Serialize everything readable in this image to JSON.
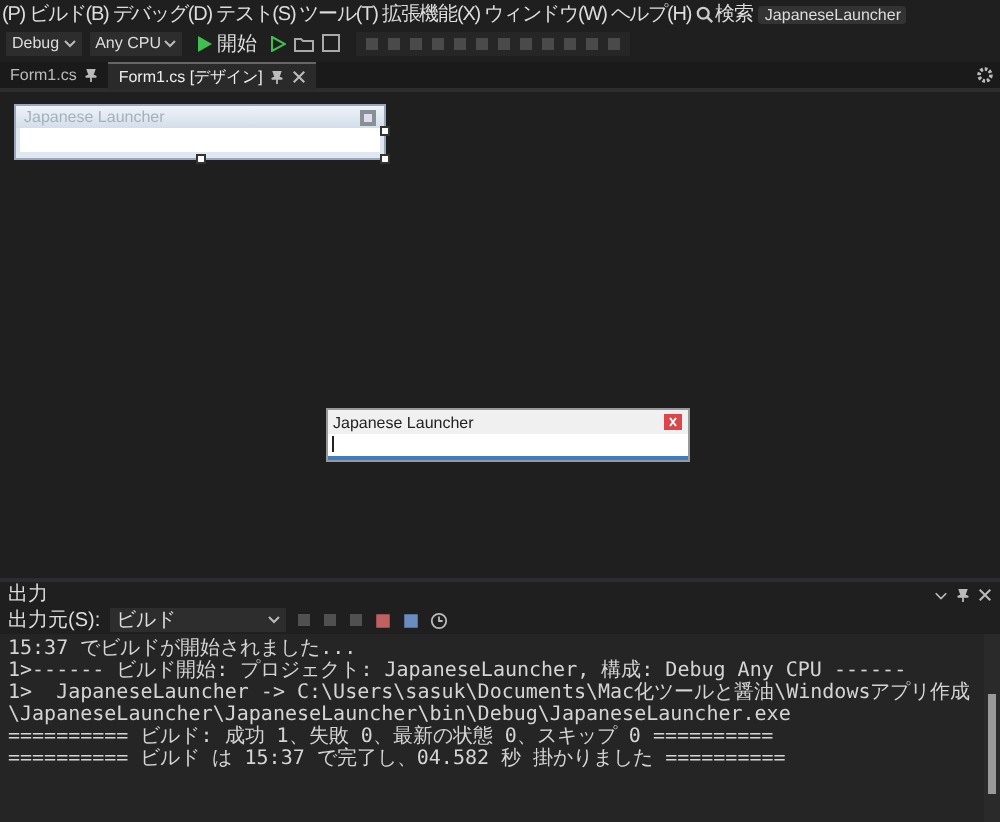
{
  "menu": {
    "items": [
      "(P)",
      "ビルド(B)",
      "デバッグ(D)",
      "テスト(S)",
      "ツール(T)",
      "拡張機能(X)",
      "ウィンドウ(W)",
      "ヘルプ(H)"
    ],
    "search": "検索",
    "solution": "JapaneseLauncher"
  },
  "toolbar": {
    "configuration": "Debug",
    "platform": "Any CPU",
    "start": "開始"
  },
  "tabs": [
    {
      "label": "Form1.cs",
      "selected": false,
      "closable": false
    },
    {
      "label": "Form1.cs [デザイン]",
      "selected": true,
      "closable": true
    }
  ],
  "designer": {
    "form_title": "Japanese Launcher"
  },
  "running_form": {
    "title": "Japanese Launcher"
  },
  "output": {
    "title": "出力",
    "source_label": "出力元(S):",
    "source": "ビルド",
    "lines": [
      "15:37 でビルドが開始されました...",
      "1>------ ビルド開始: プロジェクト: JapaneseLauncher, 構成: Debug Any CPU ------",
      "1>  JapaneseLauncher -> C:\\Users\\sasuk\\Documents\\Mac化ツールと醤油\\Windowsアプリ作成\\JapaneseLauncher\\JapaneseLauncher\\bin\\Debug\\JapaneseLauncher.exe",
      "========== ビルド: 成功 1、失敗 0、最新の状態 0、スキップ 0 ==========",
      "========== ビルド は 15:37 で完了し、04.582 秒 掛かりました =========="
    ]
  }
}
